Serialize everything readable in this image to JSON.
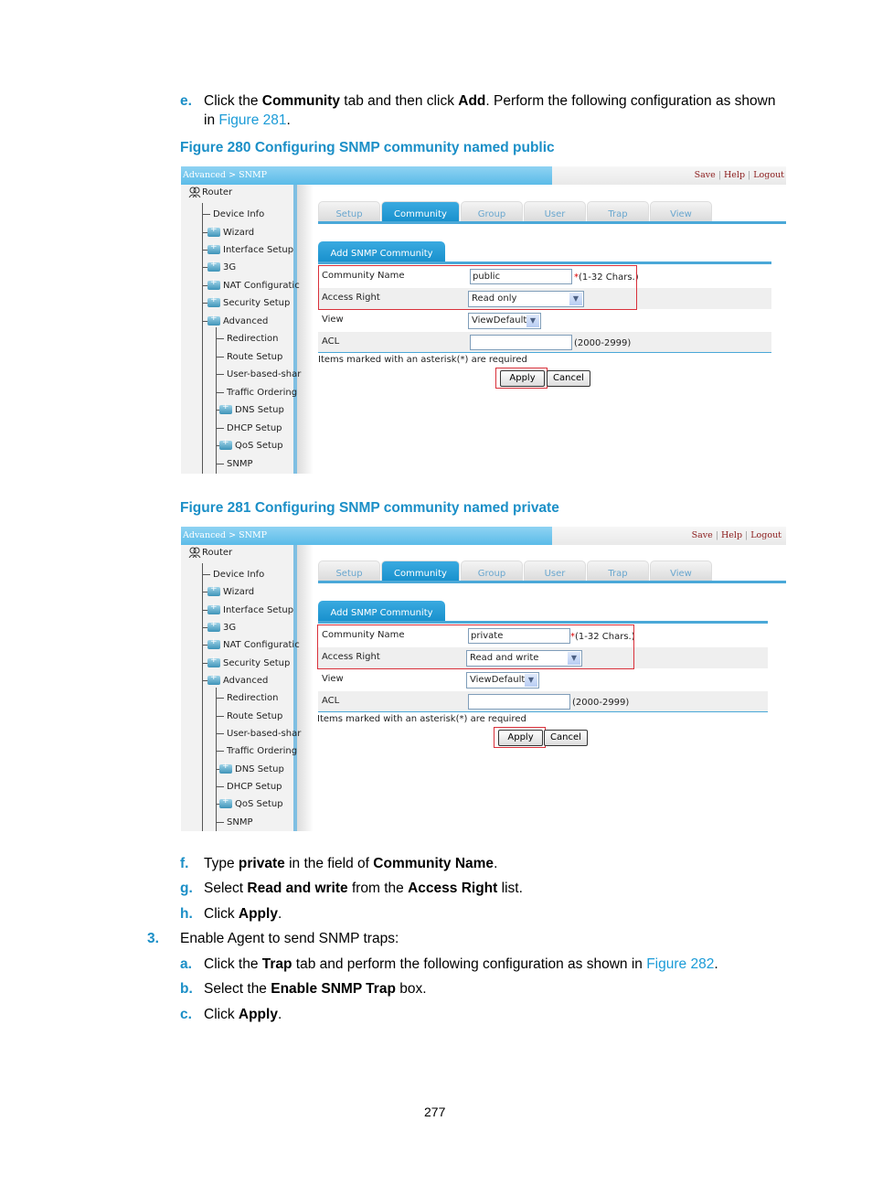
{
  "steps_top": {
    "e": {
      "marker": "e.",
      "t1": "Click the ",
      "b1": "Community",
      "t2": " tab and then click ",
      "b2": "Add",
      "t3": ". Perform the following configuration as shown",
      "t4": "in ",
      "link": "Figure 281",
      "t5": "."
    }
  },
  "figures": [
    {
      "caption": "Figure 280 Configuring SNMP community named public",
      "breadcrumb": "Advanced > SNMP",
      "header_links": [
        "Save",
        "Help",
        "Logout"
      ],
      "tree": {
        "root": "Router",
        "items": [
          "Device Info",
          "Wizard",
          "Interface Setup",
          "3G",
          "NAT Configuratic",
          "Security Setup",
          "Advanced"
        ],
        "sub_items": [
          "Redirection",
          "Route Setup",
          "User-based-shar",
          "Traffic Ordering",
          "DNS Setup",
          "DHCP Setup",
          "QoS Setup",
          "SNMP"
        ]
      },
      "tabs": [
        "Setup",
        "Community",
        "Group",
        "User",
        "Trap",
        "View"
      ],
      "active_tab": "Community",
      "subtab": "Add SNMP Community",
      "form": {
        "community_name_label": "Community Name",
        "community_name_value": "public",
        "community_name_hint_asterisk": "*",
        "community_name_hint": "(1-32 Chars.)",
        "access_right_label": "Access Right",
        "access_right_value": "Read only",
        "view_label": "View",
        "view_value": "ViewDefault",
        "acl_label": "ACL",
        "acl_value": "",
        "acl_hint": "(2000-2999)",
        "required_note": "Items marked with an asterisk(*) are required",
        "apply": "Apply",
        "cancel": "Cancel"
      }
    },
    {
      "caption": "Figure 281 Configuring SNMP community named private",
      "breadcrumb": "Advanced > SNMP",
      "header_links": [
        "Save",
        "Help",
        "Logout"
      ],
      "tree": {
        "root": "Router",
        "items": [
          "Device Info",
          "Wizard",
          "Interface Setup",
          "3G",
          "NAT Configuratic",
          "Security Setup",
          "Advanced"
        ],
        "sub_items": [
          "Redirection",
          "Route Setup",
          "User-based-shar",
          "Traffic Ordering",
          "DNS Setup",
          "DHCP Setup",
          "QoS Setup",
          "SNMP"
        ]
      },
      "tabs": [
        "Setup",
        "Community",
        "Group",
        "User",
        "Trap",
        "View"
      ],
      "active_tab": "Community",
      "subtab": "Add SNMP Community",
      "form": {
        "community_name_label": "Community Name",
        "community_name_value": "private",
        "community_name_hint_asterisk": "*",
        "community_name_hint": "(1-32 Chars.)",
        "access_right_label": "Access Right",
        "access_right_value": "Read and write",
        "view_label": "View",
        "view_value": "ViewDefault",
        "acl_label": "ACL",
        "acl_value": "",
        "acl_hint": "(2000-2999)",
        "required_note": "Items marked with an asterisk(*) are required",
        "apply": "Apply",
        "cancel": "Cancel"
      }
    }
  ],
  "steps_bottom": {
    "f": {
      "marker": "f.",
      "t1": "Type ",
      "b1": "private",
      "t2": " in the field of ",
      "b2": "Community Name",
      "t3": "."
    },
    "g": {
      "marker": "g.",
      "t1": "Select ",
      "b1": "Read and write",
      "t2": " from the ",
      "b2": "Access Right",
      "t3": " list."
    },
    "h": {
      "marker": "h.",
      "t1": "Click ",
      "b1": "Apply",
      "t2": "."
    },
    "step3": {
      "marker": "3.",
      "text": "Enable Agent to send SNMP traps:"
    },
    "a": {
      "marker": "a.",
      "t1": "Click the ",
      "b1": "Trap",
      "t2": " tab and perform the following configuration as shown in ",
      "link": "Figure 282",
      "t3": "."
    },
    "b": {
      "marker": "b.",
      "t1": "Select the ",
      "b1": "Enable SNMP Trap",
      "t2": " box."
    },
    "c": {
      "marker": "c.",
      "t1": "Click ",
      "b1": "Apply",
      "t2": "."
    }
  },
  "page_number": "277",
  "colors": {
    "accent": "#1b8fc7",
    "tab_active": "#168fcc",
    "highlight_box": "#d9303a"
  }
}
